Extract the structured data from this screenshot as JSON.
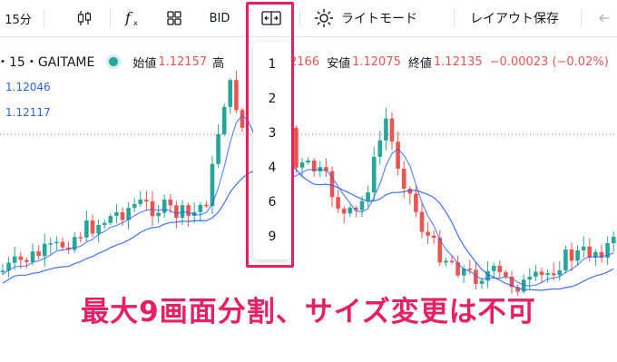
{
  "toolbar": {
    "interval": "15分",
    "indicator_label": "BID",
    "theme_label": "ライトモード",
    "save_layout": "レイアウト保存",
    "icons": [
      "candlestick-icon",
      "function-icon",
      "layout-grid-icon",
      "split-layout-icon",
      "sun-icon",
      "back-arrow-icon"
    ]
  },
  "legend": {
    "symbol": "・15・GAITAME",
    "status_color": "#26a69a",
    "open_label": "始値",
    "open_value": "1.12157",
    "high_label": "高",
    "high_value_partial": "2166",
    "low_label": "安値",
    "low_value": "1.12075",
    "close_label": "終値",
    "close_value": "1.12135",
    "change": "−0.00023 (−0.02%)",
    "value_color": "#ef5350"
  },
  "moving_averages": [
    {
      "value": "1.12046",
      "color": "#2962ff"
    },
    {
      "value": "1.12117",
      "color": "#2962ff"
    }
  ],
  "layout_dropdown": {
    "options": [
      "1",
      "2",
      "3",
      "4",
      "6",
      "9"
    ]
  },
  "caption": "最大9画面分割、サイズ変更は不可",
  "colors": {
    "up": "#26a69a",
    "down": "#ef5350",
    "highlight": "#e91e63",
    "ma_line": "#2962ff"
  }
}
